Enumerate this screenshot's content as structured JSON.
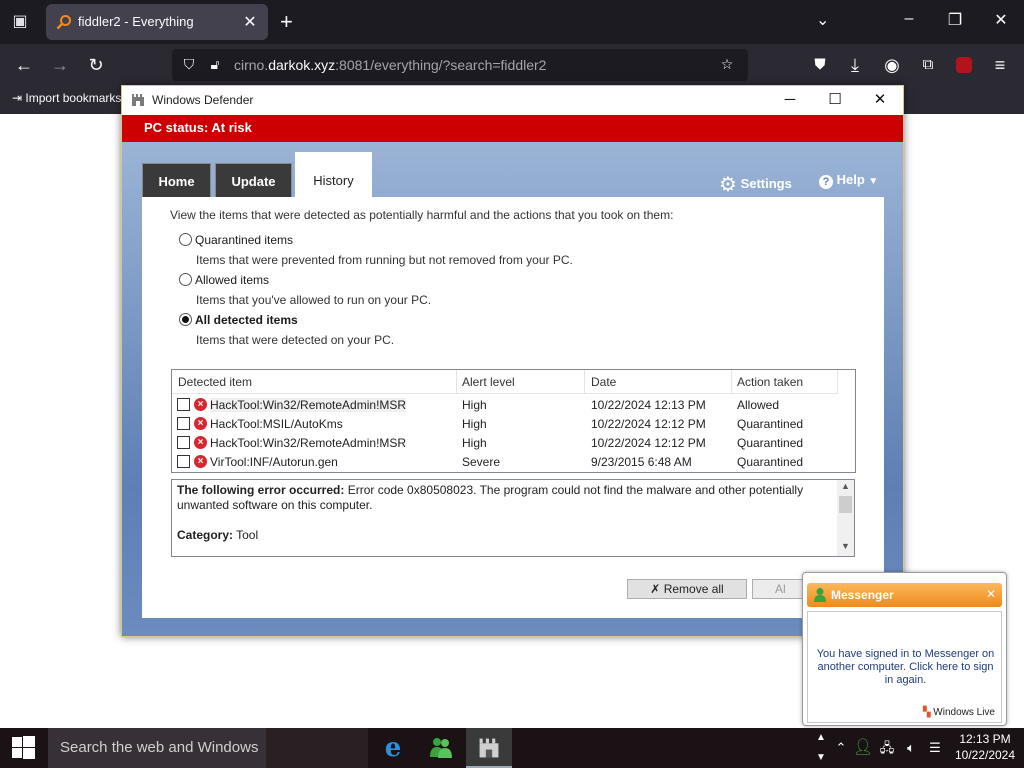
{
  "browser": {
    "tab_title": "fiddler2 - Everything",
    "url_pre": "cirno.",
    "url_host": "darkok.xyz",
    "url_post": ":8081/everything/?search=fiddler2",
    "bookmark": "Import bookmarks"
  },
  "defender": {
    "title": "Windows Defender",
    "status": "PC status: At risk",
    "tabs": [
      "Home",
      "Update",
      "History"
    ],
    "settings_label": "Settings",
    "help_label": "Help",
    "intro": "View the items that were detected as potentially harmful and the actions that you took on them:",
    "options": [
      {
        "label": "Quarantined items",
        "desc": "Items that were prevented from running but not removed from your PC.",
        "selected": false
      },
      {
        "label": "Allowed items",
        "desc": "Items that you've allowed to run on your PC.",
        "selected": false
      },
      {
        "label": "All detected items",
        "desc": "Items that were detected on your PC.",
        "selected": true
      }
    ],
    "columns": [
      "Detected item",
      "Alert level",
      "Date",
      "Action taken"
    ],
    "rows": [
      {
        "item": "HackTool:Win32/RemoteAdmin!MSR",
        "level": "High",
        "date": "10/22/2024 12:13 PM",
        "action": "Allowed"
      },
      {
        "item": "HackTool:MSIL/AutoKms",
        "level": "High",
        "date": "10/22/2024 12:12 PM",
        "action": "Quarantined"
      },
      {
        "item": "HackTool:Win32/RemoteAdmin!MSR",
        "level": "High",
        "date": "10/22/2024 12:12 PM",
        "action": "Quarantined"
      },
      {
        "item": "VirTool:INF/Autorun.gen",
        "level": "Severe",
        "date": "9/23/2015 6:48 AM",
        "action": "Quarantined"
      }
    ],
    "details_error_label": "The following error occurred:",
    "details_error_text": " Error code 0x80508023. The program could not find the malware and other potentially unwanted software on this computer.",
    "details_category_label": "Category:",
    "details_category_value": " Tool",
    "remove_all": "Remove all",
    "allow_partial": "Al"
  },
  "messenger": {
    "title": "Messenger",
    "message": "You have signed in to Messenger on another computer. Click here to sign in again.",
    "brand": "Windows Live"
  },
  "taskbar": {
    "search_placeholder": "Search the web and Windows",
    "time": "12:13 PM",
    "date": "10/22/2024"
  },
  "colors": {
    "status_red": "#cc0000",
    "messenger_orange": "#f08a1c"
  }
}
